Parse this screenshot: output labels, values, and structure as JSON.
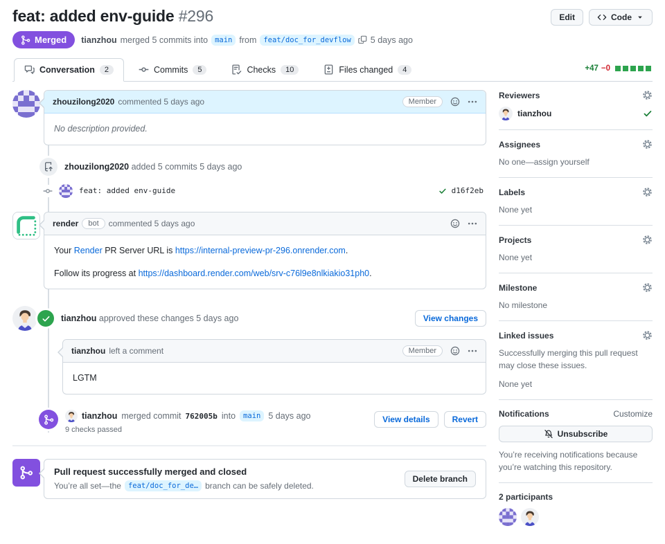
{
  "header": {
    "title": "feat: added env-guide",
    "number": "#296",
    "edit_label": "Edit",
    "code_label": "Code",
    "status_badge": "Merged",
    "meta": {
      "author": "tianzhou",
      "action": "merged 5 commits into",
      "base_branch": "main",
      "from_label": "from",
      "head_branch": "feat/doc_for_devflow",
      "time": "5 days ago"
    }
  },
  "tabs": [
    {
      "label": "Conversation",
      "count": "2"
    },
    {
      "label": "Commits",
      "count": "5"
    },
    {
      "label": "Checks",
      "count": "10"
    },
    {
      "label": "Files changed",
      "count": "4"
    }
  ],
  "diffstat": {
    "additions": "+47",
    "deletions": "−0"
  },
  "timeline": {
    "comment1": {
      "author": "zhouzilong2020",
      "action": "commented 5 days ago",
      "badge": "Member",
      "body": "No description provided."
    },
    "commits_event": {
      "author": "zhouzilong2020",
      "action": "added 5 commits 5 days ago"
    },
    "commit_row": {
      "message": "feat: added env-guide",
      "sha": "d16f2eb"
    },
    "bot_comment": {
      "author": "render",
      "badge": "bot",
      "action": "commented 5 days ago",
      "line1_prefix": "Your ",
      "line1_link1": "Render",
      "line1_mid": " PR Server URL is ",
      "line1_link2": "https://internal-preview-pr-296.onrender.com",
      "line1_suffix": ".",
      "line2_prefix": "Follow its progress at ",
      "line2_link": "https://dashboard.render.com/web/srv-c76l9e8nlkiakio31ph0",
      "line2_suffix": "."
    },
    "review_event": {
      "author": "tianzhou",
      "action": "approved these changes 5 days ago",
      "button": "View changes"
    },
    "review_comment": {
      "author": "tianzhou",
      "action": "left a comment",
      "badge": "Member",
      "body": "LGTM"
    },
    "merge_event": {
      "author": "tianzhou",
      "action_prefix": "merged commit",
      "sha": "762005b",
      "into_label": "into",
      "branch": "main",
      "time": "5 days ago",
      "checks": "9 checks passed",
      "view_details": "View details",
      "revert": "Revert"
    },
    "merged_banner": {
      "title": "Pull request successfully merged and closed",
      "text_prefix": "You’re all set—the",
      "branch": "feat/doc_for_de…",
      "text_suffix": "branch can be safely deleted.",
      "button": "Delete branch"
    }
  },
  "sidebar": {
    "reviewers": {
      "title": "Reviewers",
      "name": "tianzhou"
    },
    "assignees": {
      "title": "Assignees",
      "empty": "No one—assign yourself"
    },
    "labels": {
      "title": "Labels",
      "empty": "None yet"
    },
    "projects": {
      "title": "Projects",
      "empty": "None yet"
    },
    "milestone": {
      "title": "Milestone",
      "empty": "No milestone"
    },
    "linked_issues": {
      "title": "Linked issues",
      "description": "Successfully merging this pull request may close these issues.",
      "empty": "None yet"
    },
    "notifications": {
      "title": "Notifications",
      "customize": "Customize",
      "button": "Unsubscribe",
      "description": "You’re receiving notifications because you’re watching this repository."
    },
    "participants": {
      "title": "2 participants"
    }
  },
  "colors": {
    "merged_purple": "#8250df",
    "link_blue": "#0969da",
    "success_green": "#2da44e",
    "addition_green": "#1a7f37",
    "deletion_red": "#d1242f",
    "branch_badge_bg": "#ddf4ff"
  }
}
